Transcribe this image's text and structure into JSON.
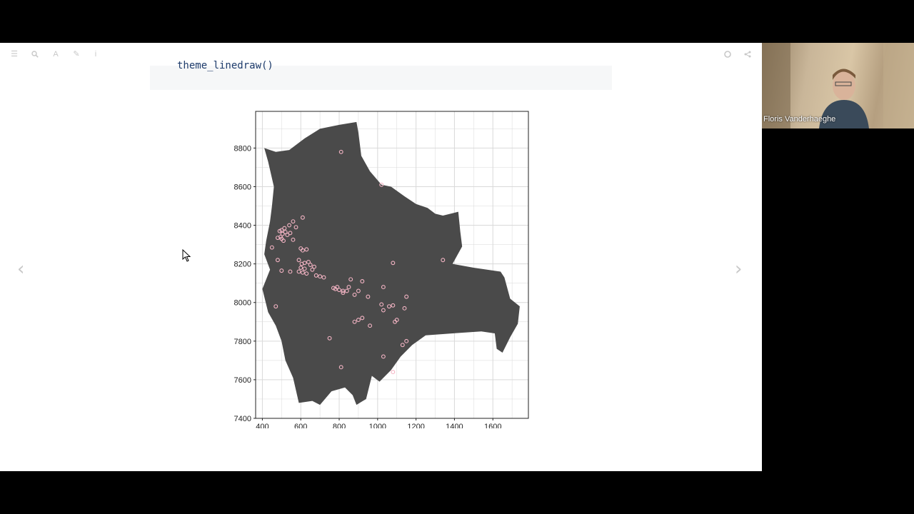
{
  "toolbar": {
    "left_icons": [
      "menu-icon",
      "search-icon",
      "font-icon",
      "edit-icon",
      "info-icon"
    ],
    "right_icons": [
      "github-icon",
      "share-icon"
    ]
  },
  "code": {
    "line": "theme_linedraw()"
  },
  "navigation": {
    "prev_glyph": "‹",
    "next_glyph": "›"
  },
  "webcam": {
    "participant_name": "Floris Vanderhaeghe"
  },
  "colors": {
    "map_fill": "#4a4a4a",
    "point_stroke": "#f5b5c5",
    "grid": "#d9d9d9",
    "code_text": "#1d3b6b"
  },
  "chart_data": {
    "type": "scatter",
    "title": "",
    "xlabel": "",
    "ylabel": "",
    "xlim": [
      365,
      1785
    ],
    "ylim": [
      7400,
      8990
    ],
    "x_ticks": [
      "400",
      "600",
      "800",
      "1000",
      "1200",
      "1600"
    ],
    "y_ticks": [
      "7400",
      "7600",
      "7800",
      "8000",
      "8200",
      "8400",
      "8600",
      "8800"
    ],
    "x_tick_values": [
      400,
      600,
      800,
      1000,
      1200,
      1600
    ],
    "x_tick_labels_extra": {
      "value": 1400,
      "label": "1400"
    },
    "y_tick_values": [
      7400,
      7600,
      7800,
      8000,
      8200,
      8400,
      8600,
      8800
    ],
    "grid": true,
    "theme": "linedraw",
    "region_outline": [
      [
        800,
        8920
      ],
      [
        890,
        8935
      ],
      [
        900,
        8880
      ],
      [
        915,
        8760
      ],
      [
        960,
        8680
      ],
      [
        1020,
        8610
      ],
      [
        1070,
        8600
      ],
      [
        1140,
        8550
      ],
      [
        1200,
        8510
      ],
      [
        1260,
        8490
      ],
      [
        1300,
        8460
      ],
      [
        1340,
        8450
      ],
      [
        1420,
        8470
      ],
      [
        1430,
        8370
      ],
      [
        1440,
        8290
      ],
      [
        1390,
        8200
      ],
      [
        1500,
        8180
      ],
      [
        1640,
        8160
      ],
      [
        1660,
        8130
      ],
      [
        1690,
        8020
      ],
      [
        1740,
        7980
      ],
      [
        1730,
        7890
      ],
      [
        1690,
        7820
      ],
      [
        1650,
        7740
      ],
      [
        1620,
        7760
      ],
      [
        1610,
        7840
      ],
      [
        1540,
        7850
      ],
      [
        1390,
        7840
      ],
      [
        1250,
        7830
      ],
      [
        1180,
        7780
      ],
      [
        1120,
        7720
      ],
      [
        1070,
        7650
      ],
      [
        1010,
        7590
      ],
      [
        970,
        7620
      ],
      [
        940,
        7500
      ],
      [
        890,
        7470
      ],
      [
        870,
        7520
      ],
      [
        830,
        7560
      ],
      [
        760,
        7540
      ],
      [
        700,
        7470
      ],
      [
        660,
        7490
      ],
      [
        590,
        7480
      ],
      [
        560,
        7610
      ],
      [
        520,
        7700
      ],
      [
        500,
        7800
      ],
      [
        470,
        7880
      ],
      [
        430,
        7950
      ],
      [
        400,
        8070
      ],
      [
        440,
        8170
      ],
      [
        410,
        8250
      ],
      [
        420,
        8320
      ],
      [
        440,
        8420
      ],
      [
        450,
        8500
      ],
      [
        460,
        8600
      ],
      [
        430,
        8730
      ],
      [
        410,
        8800
      ],
      [
        470,
        8780
      ],
      [
        540,
        8790
      ],
      [
        620,
        8850
      ],
      [
        700,
        8900
      ]
    ],
    "points": [
      [
        810,
        8780
      ],
      [
        1020,
        8610
      ],
      [
        610,
        8440
      ],
      [
        560,
        8420
      ],
      [
        540,
        8400
      ],
      [
        575,
        8390
      ],
      [
        515,
        8385
      ],
      [
        500,
        8375
      ],
      [
        490,
        8370
      ],
      [
        520,
        8365
      ],
      [
        545,
        8360
      ],
      [
        505,
        8355
      ],
      [
        530,
        8350
      ],
      [
        495,
        8340
      ],
      [
        480,
        8335
      ],
      [
        500,
        8330
      ],
      [
        560,
        8325
      ],
      [
        510,
        8320
      ],
      [
        450,
        8285
      ],
      [
        600,
        8280
      ],
      [
        630,
        8275
      ],
      [
        610,
        8270
      ],
      [
        480,
        8220
      ],
      [
        590,
        8220
      ],
      [
        640,
        8210
      ],
      [
        620,
        8205
      ],
      [
        605,
        8200
      ],
      [
        650,
        8195
      ],
      [
        670,
        8185
      ],
      [
        600,
        8180
      ],
      [
        620,
        8175
      ],
      [
        660,
        8170
      ],
      [
        500,
        8165
      ],
      [
        545,
        8160
      ],
      [
        590,
        8160
      ],
      [
        610,
        8155
      ],
      [
        630,
        8150
      ],
      [
        680,
        8140
      ],
      [
        700,
        8135
      ],
      [
        720,
        8130
      ],
      [
        1080,
        8205
      ],
      [
        1340,
        8220
      ],
      [
        790,
        8080
      ],
      [
        770,
        8075
      ],
      [
        780,
        8070
      ],
      [
        800,
        8065
      ],
      [
        820,
        8060
      ],
      [
        850,
        8080
      ],
      [
        860,
        8120
      ],
      [
        920,
        8110
      ],
      [
        900,
        8060
      ],
      [
        880,
        8040
      ],
      [
        950,
        8030
      ],
      [
        1030,
        8080
      ],
      [
        1150,
        8030
      ],
      [
        820,
        8050
      ],
      [
        840,
        8060
      ],
      [
        470,
        7980
      ],
      [
        1020,
        7990
      ],
      [
        1060,
        7980
      ],
      [
        1080,
        7985
      ],
      [
        1140,
        7970
      ],
      [
        1030,
        7960
      ],
      [
        920,
        7920
      ],
      [
        900,
        7910
      ],
      [
        880,
        7900
      ],
      [
        1090,
        7900
      ],
      [
        1100,
        7910
      ],
      [
        960,
        7880
      ],
      [
        750,
        7815
      ],
      [
        1150,
        7800
      ],
      [
        1130,
        7780
      ],
      [
        1030,
        7720
      ],
      [
        810,
        7665
      ],
      [
        1080,
        7640
      ]
    ]
  }
}
